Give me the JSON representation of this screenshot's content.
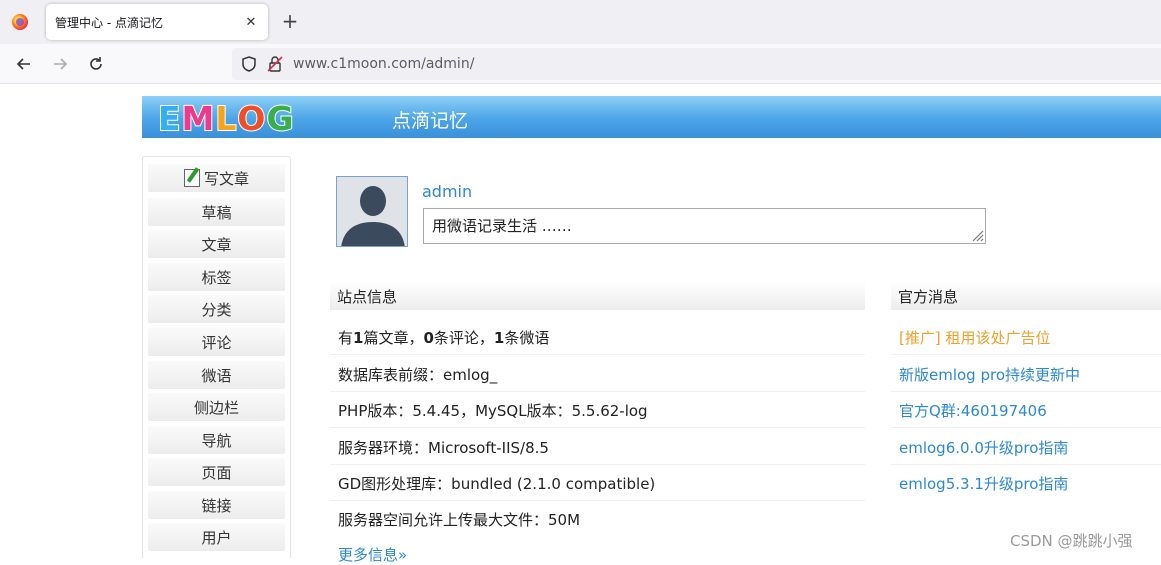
{
  "browser": {
    "tab_title": "管理中心 - 点滴记忆",
    "url": "www.c1moon.com/admin/",
    "new_tab": "+",
    "close": "✕"
  },
  "header": {
    "logo_letters": [
      "E",
      "M",
      "L",
      "O",
      "G"
    ],
    "logo_colors": [
      "#33b0f2",
      "#ee3a8c",
      "#f7a21b",
      "#ef4f28",
      "#38b04a"
    ],
    "site_name": "点滴记忆"
  },
  "sidebar": {
    "items": [
      {
        "label": "写文章",
        "icon": "pencil-icon"
      },
      {
        "label": "草稿"
      },
      {
        "label": "文章"
      },
      {
        "label": "标签"
      },
      {
        "label": "分类"
      },
      {
        "label": "评论"
      },
      {
        "label": "微语"
      },
      {
        "label": "侧边栏"
      },
      {
        "label": "导航"
      },
      {
        "label": "页面"
      },
      {
        "label": "链接"
      },
      {
        "label": "用户"
      }
    ]
  },
  "profile": {
    "username": "admin",
    "twitter_value": "用微语记录生活 ……"
  },
  "site_info": {
    "title": "站点信息",
    "stats": {
      "p1": "有",
      "articles": "1",
      "p2": "篇文章，",
      "comments": "0",
      "p3": "条评论，",
      "twitters": "1",
      "p4": "条微语"
    },
    "rows": [
      "数据库表前缀：emlog_",
      "PHP版本：5.4.45，MySQL版本：5.5.62-log",
      "服务器环境：Microsoft-IIS/8.5",
      "GD图形处理库：bundled (2.1.0 compatible)",
      "服务器空间允许上传最大文件：50M"
    ],
    "more": "更多信息»"
  },
  "official_news": {
    "title": "官方消息",
    "items": [
      "[推广] 租用该处广告位",
      "新版emlog pro持续更新中",
      "官方Q群:460197406",
      "emlog6.0.0升级pro指南",
      "emlog5.3.1升级pro指南"
    ]
  },
  "watermark": "CSDN @跳跳小强",
  "colors": {
    "link": "#2b89cf",
    "ad": "#f0a02a",
    "banner": "#4ba5e6"
  }
}
